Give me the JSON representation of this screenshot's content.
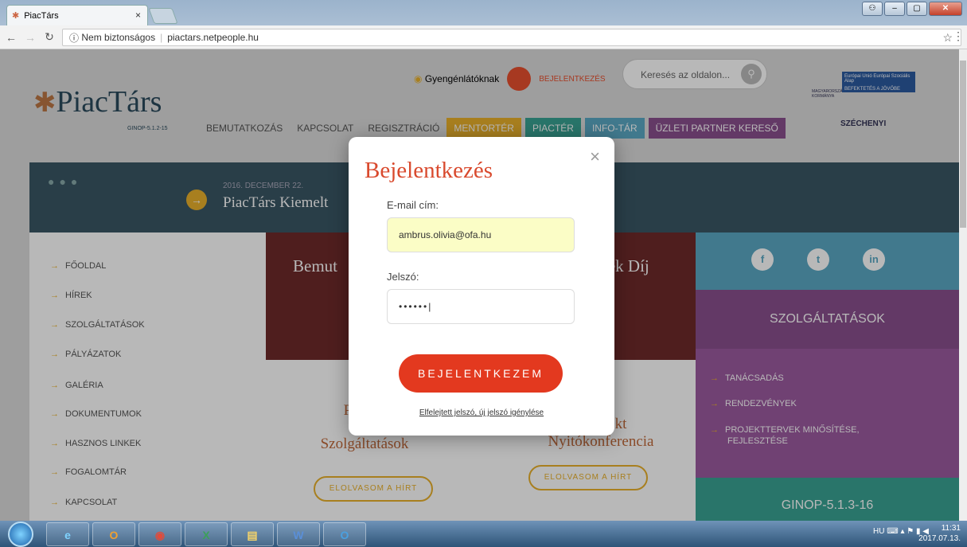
{
  "browser": {
    "tab_title": "PiacTárs",
    "tab_close": "×",
    "security": "Nem biztonságos",
    "url": "piactars.netpeople.hu"
  },
  "header": {
    "logo": "PiacTárs",
    "logo_sub": "GINOP-5.1.2-15",
    "accessibility": "Gyengénlátóknak",
    "login": "BEJELENTKEZÉS",
    "search_placeholder": "Keresés az oldalon...",
    "nav": [
      "BEMUTATKOZÁS",
      "KAPCSOLAT",
      "REGISZTRÁCIÓ",
      "MENTORTÉR",
      "PIACTÉR",
      "INFO-TÁR",
      "ÜZLETI PARTNER KERESŐ"
    ],
    "eu_text": "Európai Unió Európai Szociális Alap",
    "eu_slogan": "BEFEKTETÉS A JÖVŐBE",
    "gov": "MAGYARORSZÁG KORMÁNYA",
    "szechenyi": "SZÉCHENYI"
  },
  "banner": {
    "date": "2016. DECEMBER 22.",
    "title": "PiacTárs Kiemelt"
  },
  "sidebar": [
    "FŐOLDAL",
    "HÍREK",
    "SZOLGÁLTATÁSOK",
    "PÁLYÁZATOK",
    "GALÉRIA",
    "DOKUMENTUMOK",
    "HASZNOS LINKEK",
    "FOGALOMTÁR",
    "KAPCSOLAT"
  ],
  "content": {
    "card_left": "Bemut",
    "card_right": "ték Díj",
    "news1_line1": "PiacTá",
    "news1_line2": "Szolgáltatások",
    "news2_line1": "t Projekt",
    "news2_line2": "Nyitókonferencia",
    "read_more": "ELOLVASOM A HÍRT"
  },
  "right": {
    "social": [
      "f",
      "t",
      "in"
    ],
    "services_title": "SZOLGÁLTATÁSOK",
    "services": [
      "TANÁCSADÁS",
      "RENDEZVÉNYEK",
      "PROJEKTTERVEK MINŐSÍTÉSE, FEJLESZTÉSE"
    ],
    "ginop": "GINOP-5.1.3-16"
  },
  "modal": {
    "title": "Bejelentkezés",
    "close": "×",
    "email_label": "E-mail cím:",
    "email_value": "ambrus.olivia@ofa.hu",
    "password_label": "Jelszó:",
    "password_value": "••••••|",
    "submit": "BEJELENTKEZEM",
    "forgot": "Elfelejtett jelszó, új jelszó igénylése"
  },
  "taskbar": {
    "apps": [
      "e",
      "O",
      "◉",
      "X",
      "▤",
      "W",
      "O"
    ],
    "lang": "HU",
    "time": "11:31",
    "date": "2017.07.13."
  }
}
